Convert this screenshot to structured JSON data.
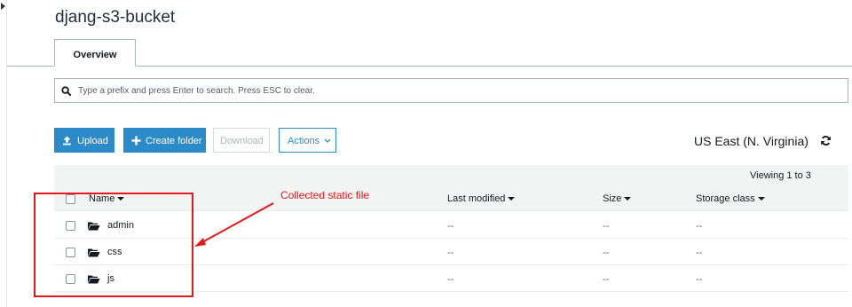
{
  "bucket": {
    "title": "djang-s3-bucket"
  },
  "tabs": [
    {
      "label": "Overview"
    }
  ],
  "search": {
    "placeholder": "Type a prefix and press Enter to search. Press ESC to clear."
  },
  "toolbar": {
    "upload_label": "Upload",
    "create_folder_label": "Create folder",
    "download_label": "Download",
    "actions_label": "Actions"
  },
  "region": "US East (N. Virginia)",
  "table": {
    "viewing": "Viewing 1 to 3",
    "columns": {
      "name": "Name",
      "last_modified": "Last modified",
      "size": "Size",
      "storage_class": "Storage class"
    },
    "rows": [
      {
        "name": "admin",
        "last_modified": "--",
        "size": "--",
        "storage_class": "--"
      },
      {
        "name": "css",
        "last_modified": "--",
        "size": "--",
        "storage_class": "--"
      },
      {
        "name": "js",
        "last_modified": "--",
        "size": "--",
        "storage_class": "--"
      }
    ]
  },
  "annotation": {
    "text": "Collected static file",
    "color": "#e3191a"
  },
  "colors": {
    "primary": "#2b8bc9",
    "header_bg": "#f2f3f3"
  },
  "icons": {
    "search": "search-icon",
    "upload": "upload-icon",
    "create": "plus-icon",
    "folder": "folder-open-icon",
    "refresh": "refresh-icon"
  }
}
